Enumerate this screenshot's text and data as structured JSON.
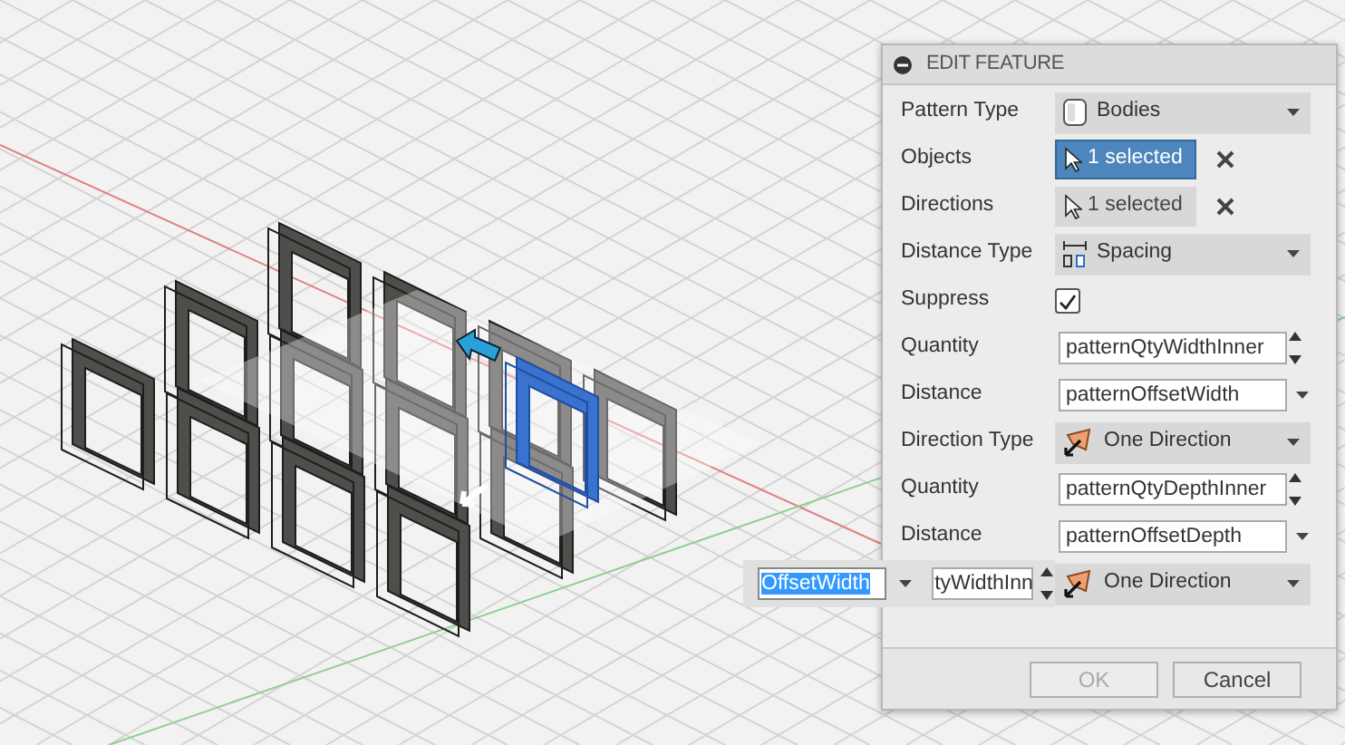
{
  "panel": {
    "title": "EDIT FEATURE",
    "rows": [
      {
        "kind": "dropdown",
        "label": "Pattern Type",
        "value": "Bodies"
      },
      {
        "kind": "selection",
        "label": "Objects",
        "value": "1 selected",
        "selected": true
      },
      {
        "kind": "selection",
        "label": "Directions",
        "value": "1 selected",
        "selected": false
      },
      {
        "kind": "dropdown",
        "label": "Distance Type",
        "value": "Spacing"
      },
      {
        "kind": "checkbox",
        "label": "Suppress",
        "checked": true
      },
      {
        "kind": "spinner",
        "label": "Quantity",
        "value": "patternQtyWidthInner"
      },
      {
        "kind": "combo",
        "label": "Distance",
        "value": "patternOffsetWidth"
      },
      {
        "kind": "dropdown",
        "label": "Direction Type",
        "value": "One Direction"
      },
      {
        "kind": "spinner",
        "label": "Quantity",
        "value": "patternQtyDepthInner"
      },
      {
        "kind": "combo",
        "label": "Distance",
        "value": "patternOffsetDepth"
      },
      {
        "kind": "dropdown",
        "value": "One Direction"
      }
    ],
    "buttons": [
      {
        "label": "OK",
        "disabled": true
      },
      {
        "label": "Cancel",
        "disabled": false
      }
    ]
  },
  "inline_editor": {
    "distance_value": "OffsetWidth",
    "text_selected": true,
    "quantity_value": "tyWidthInn"
  }
}
